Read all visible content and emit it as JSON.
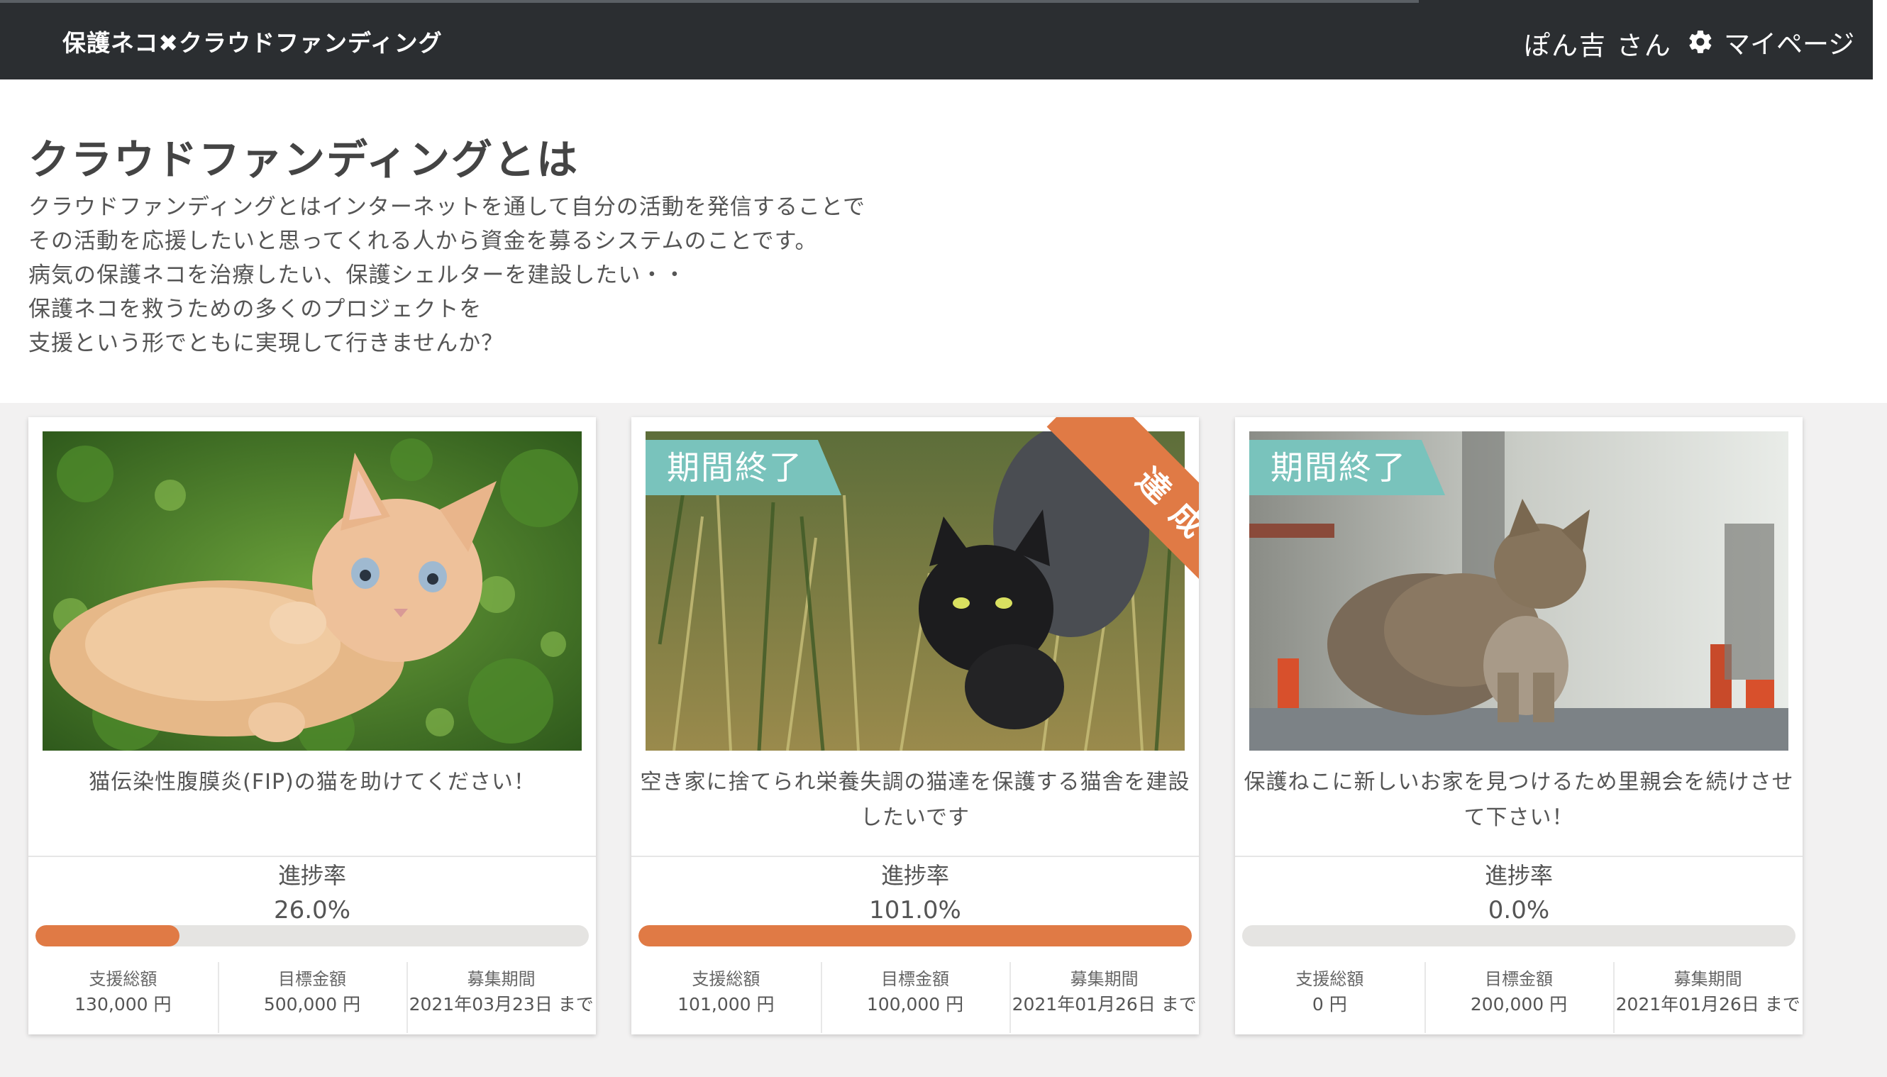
{
  "header": {
    "brand": "保護ネコ✖クラウドファンディング",
    "user": "ぽん吉 さん",
    "mypage": "マイページ"
  },
  "intro": {
    "heading": "クラウドファンディングとは",
    "lines": [
      "クラウドファンディングとはインターネットを通して自分の活動を発信することで",
      "その活動を応援したいと思ってくれる人から資金を募るシステムのことです。",
      "病気の保護ネコを治療したい、保護シェルターを建設したい・・",
      "保護ネコを救うための多くのプロジェクトを",
      "支援という形でともに実現して行きませんか？"
    ]
  },
  "labels": {
    "progress": "進捗率",
    "total_support": "支援総額",
    "goal": "目標金額",
    "period": "募集期間",
    "ended": "期間終了",
    "achieved": "達成"
  },
  "projects": [
    {
      "title": "猫伝染性腹膜炎(FIP)の猫を助けてください！",
      "progress_text": "26.0%",
      "progress": 0.26,
      "total_support": "130,000 円",
      "goal": "500,000 円",
      "period": "2021年03月23日 まで"
    },
    {
      "title": "空き家に捨てられ栄養失調の猫達を保護する猫舎を建設したいです",
      "progress_text": "101.0%",
      "progress": 1.01,
      "total_support": "101,000 円",
      "goal": "100,000 円",
      "period": "2021年01月26日 まで"
    },
    {
      "title": "保護ねこに新しいお家を見つけるため里親会を続けさせて下さい！",
      "progress_text": "0.0%",
      "progress": 0.0,
      "total_support": "0 円",
      "goal": "200,000 円",
      "period": "2021年01月26日 まで"
    }
  ],
  "colors": {
    "navbar": "#2b2e31",
    "accent": "#e07a45",
    "ended_tag": "#79c3bc"
  },
  "icons": {
    "mypage": "gear-icon"
  }
}
